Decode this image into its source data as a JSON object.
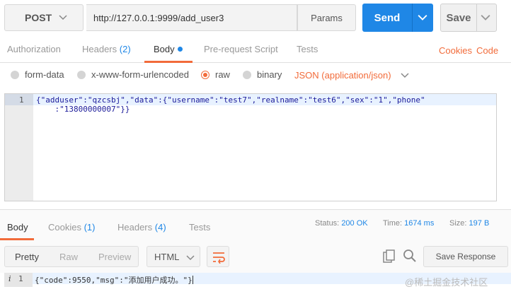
{
  "request": {
    "method": "POST",
    "url": "http://127.0.0.1:9999/add_user3",
    "params_label": "Params",
    "send_label": "Send",
    "save_label": "Save"
  },
  "tabs": [
    {
      "label": "Authorization"
    },
    {
      "label": "Headers",
      "count": "(2)"
    },
    {
      "label": "Body"
    },
    {
      "label": "Pre-request Script"
    },
    {
      "label": "Tests"
    }
  ],
  "right_links": {
    "cookies": "Cookies",
    "code": "Code"
  },
  "body_options": {
    "form_data": "form-data",
    "urlencoded": "x-www-form-urlencoded",
    "raw": "raw",
    "binary": "binary",
    "content_type": "JSON (application/json)"
  },
  "editor": {
    "line_number": "1",
    "line1": "{\"adduser\":\"qzcsbj\",\"data\":{\"username\":\"test7\",\"realname\":\"test6\",\"sex\":\"1\",\"phone\"",
    "line1_wrap": "    :\"13800000007\"}}"
  },
  "response_tabs": [
    {
      "label": "Body"
    },
    {
      "label": "Cookies",
      "count": "(1)"
    },
    {
      "label": "Headers",
      "count": "(4)"
    },
    {
      "label": "Tests"
    }
  ],
  "meta": {
    "status_label": "Status:",
    "status_value": "200 OK",
    "time_label": "Time:",
    "time_value": "1674 ms",
    "size_label": "Size:",
    "size_value": "197 B"
  },
  "view": {
    "pretty": "Pretty",
    "raw": "Raw",
    "preview": "Preview",
    "format": "HTML",
    "save_response": "Save Response"
  },
  "response": {
    "info": "i",
    "line_number": "1",
    "text": "{\"code\":9550,\"msg\":\"添加用户成功。\"}"
  },
  "watermark": "@稀土掘金技术社区",
  "colors": {
    "accent": "#f26b3a",
    "primary": "#1f87e6"
  }
}
